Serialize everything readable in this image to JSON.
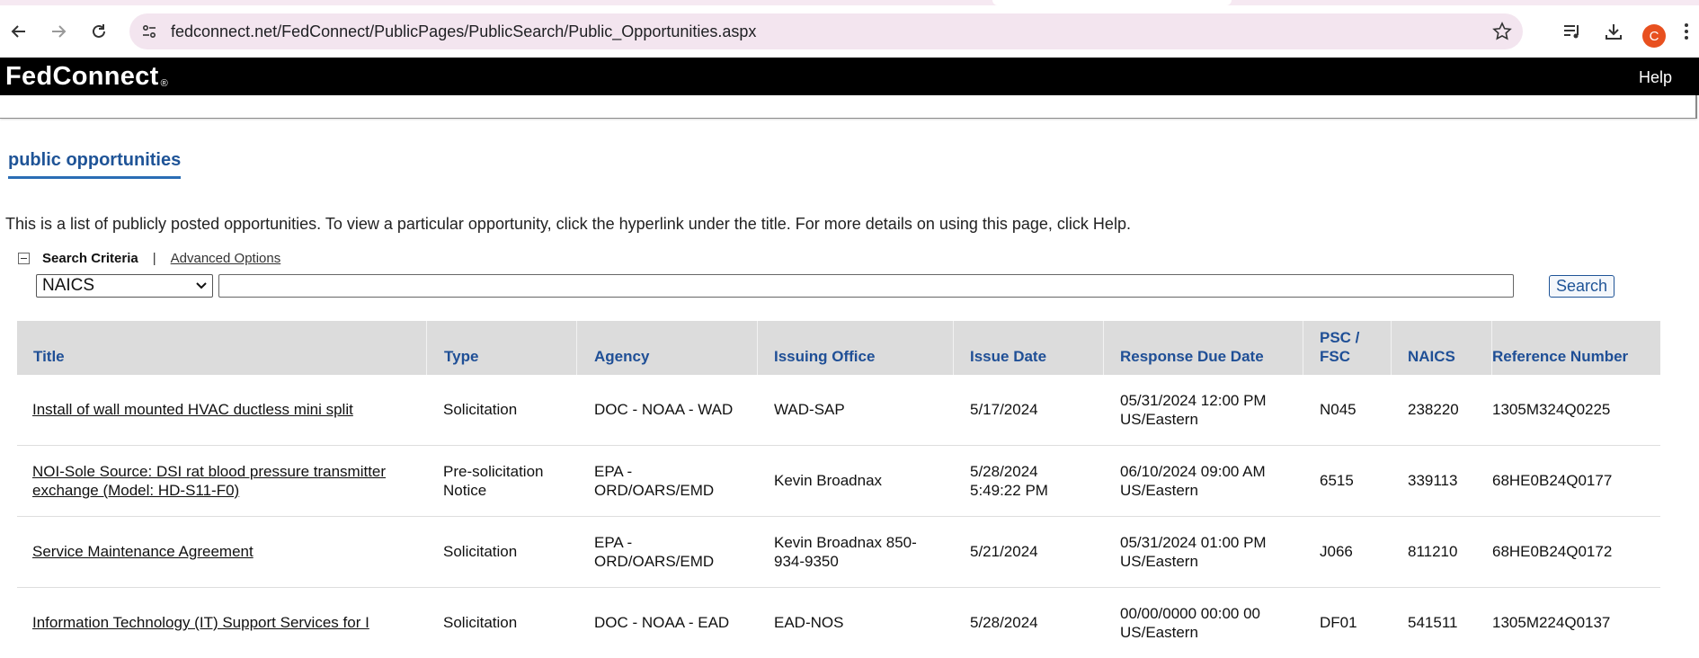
{
  "browser": {
    "url": "fedconnect.net/FedConnect/PublicPages/PublicSearch/Public_Opportunities.aspx",
    "avatar_letter": "C"
  },
  "site": {
    "logo": "FedConnect",
    "logo_mark": "®",
    "help_label": "Help"
  },
  "page": {
    "title": "public opportunities",
    "intro": "This is a list of publicly posted opportunities. To view a particular opportunity, click the hyperlink under the title. For more details on using this page, click Help."
  },
  "search": {
    "criteria_label": "Search Criteria",
    "separator": "|",
    "advanced_label": "Advanced Options",
    "field_selected": "NAICS",
    "query_value": "",
    "button_label": "Search"
  },
  "table": {
    "headers": {
      "title": "Title",
      "type": "Type",
      "agency": "Agency",
      "issuing_office": "Issuing Office",
      "issue_date": "Issue Date",
      "response_due_date": "Response Due Date",
      "psc_fsc": "PSC / FSC",
      "naics": "NAICS",
      "reference_number": "Reference Number"
    },
    "rows": [
      {
        "title": "Install of wall mounted HVAC ductless mini split",
        "type": "Solicitation",
        "agency": "DOC - NOAA - WAD",
        "issuing_office": "WAD-SAP",
        "issue_date": "5/17/2024",
        "response_due_date": "05/31/2024 12:00 PM US/Eastern",
        "psc_fsc": "N045",
        "naics": "238220",
        "reference_number": "1305M324Q0225"
      },
      {
        "title": "NOI-Sole Source: DSI rat blood pressure transmitter exchange (Model: HD-S11-F0)",
        "type": "Pre-solicitation Notice",
        "agency": "EPA - ORD/OARS/EMD",
        "issuing_office": "Kevin Broadnax",
        "issue_date": "5/28/2024 5:49:22 PM",
        "response_due_date": "06/10/2024 09:00 AM US/Eastern",
        "psc_fsc": "6515",
        "naics": "339113",
        "reference_number": "68HE0B24Q0177"
      },
      {
        "title": "Service Maintenance Agreement",
        "type": "Solicitation",
        "agency": "EPA - ORD/OARS/EMD",
        "issuing_office": "Kevin Broadnax 850-934-9350",
        "issue_date": "5/21/2024",
        "response_due_date": "05/31/2024 01:00 PM US/Eastern",
        "psc_fsc": "J066",
        "naics": "811210",
        "reference_number": "68HE0B24Q0172"
      },
      {
        "title": "Information Technology (IT) Support Services for I",
        "type": "Solicitation",
        "agency": "DOC - NOAA - EAD",
        "issuing_office": "EAD-NOS",
        "issue_date": "5/28/2024",
        "response_due_date": "00/00/0000 00:00 00 US/Eastern",
        "psc_fsc": "DF01",
        "naics": "541511",
        "reference_number": "1305M224Q0137"
      }
    ]
  },
  "colors": {
    "header_bg": "#000000",
    "accent_blue": "#1f5497",
    "table_header_bg": "#dcdcdc",
    "omnibox_bg": "#f3e5ef"
  }
}
